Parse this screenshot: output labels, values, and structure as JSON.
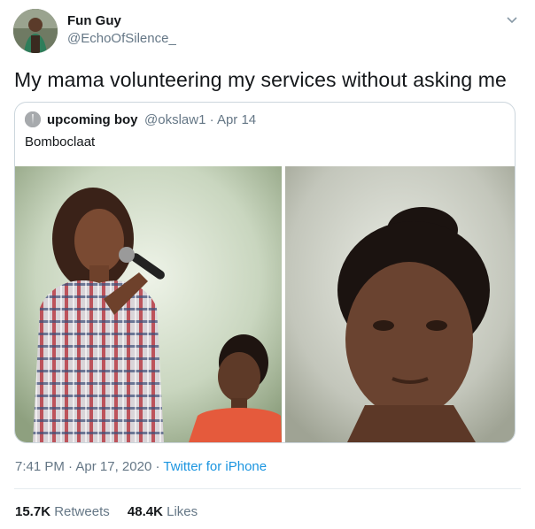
{
  "author": {
    "name": "Fun Guy",
    "handle": "@EchoOfSilence_",
    "avatar_icon": "profile-photo"
  },
  "tweet": {
    "text": "My mama volunteering my services without asking me"
  },
  "quoted": {
    "name": "upcoming boy",
    "handle": "@okslaw1",
    "sep": "·",
    "date": "Apr 14",
    "text": "Bomboclaat",
    "media": [
      {
        "content": "photo-woman-speaking-with-microphone-beside-girl"
      },
      {
        "content": "photo-girl-closeup-side-eye"
      }
    ]
  },
  "meta": {
    "time": "7:41 PM",
    "sep1": "·",
    "date": "Apr 17, 2020",
    "sep2": "·",
    "source": "Twitter for iPhone"
  },
  "stats": {
    "retweets_count": "15.7K",
    "retweets_label": "Retweets",
    "likes_count": "48.4K",
    "likes_label": "Likes"
  },
  "colors": {
    "text": "#14171a",
    "secondary": "#657786",
    "link": "#1b95e0",
    "border": "#ccd6dd"
  },
  "icons": {
    "menu": "chevron-down-icon"
  }
}
